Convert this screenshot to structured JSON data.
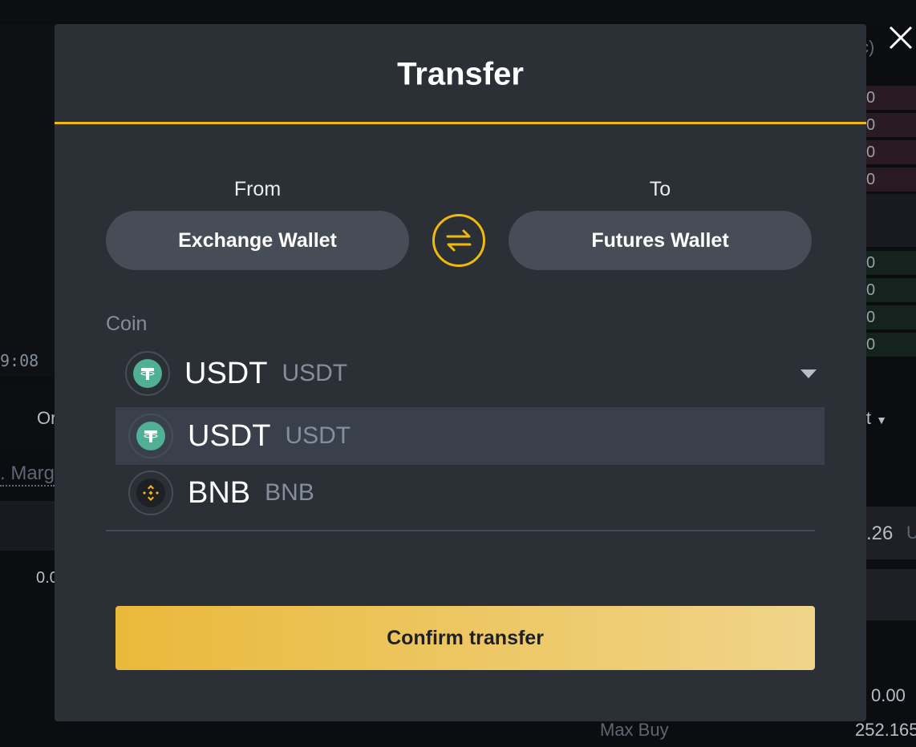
{
  "background": {
    "time_fragment": "9:08",
    "tab_fragment": "Or",
    "margin_fragment": ". Marg",
    "value_fragment_left": "0.0",
    "order_type_fragment": "it",
    "price_fragment": ".26",
    "unit_fragment": "U",
    "orderbook_header_fragment": "c)",
    "orderbook_values": [
      "0",
      "0",
      "0",
      "0",
      "0",
      "0",
      "0",
      "0"
    ],
    "cost_value": "0.00",
    "max_buy_label": "Max Buy",
    "max_buy_value": "252.165"
  },
  "modal": {
    "title": "Transfer",
    "from_label": "From",
    "to_label": "To",
    "from_wallet": "Exchange Wallet",
    "to_wallet": "Futures Wallet",
    "coin_label": "Coin",
    "selected_coin": {
      "symbol": "USDT",
      "name": "USDT",
      "icon": "tether-icon"
    },
    "options": [
      {
        "symbol": "USDT",
        "name": "USDT",
        "icon": "tether-icon",
        "highlighted": true
      },
      {
        "symbol": "BNB",
        "name": "BNB",
        "icon": "bnb-icon",
        "highlighted": false
      }
    ],
    "confirm_label": "Confirm transfer"
  },
  "colors": {
    "accent": "#f0b90b",
    "modal_bg": "#2b2f36",
    "tether": "#50af95"
  }
}
